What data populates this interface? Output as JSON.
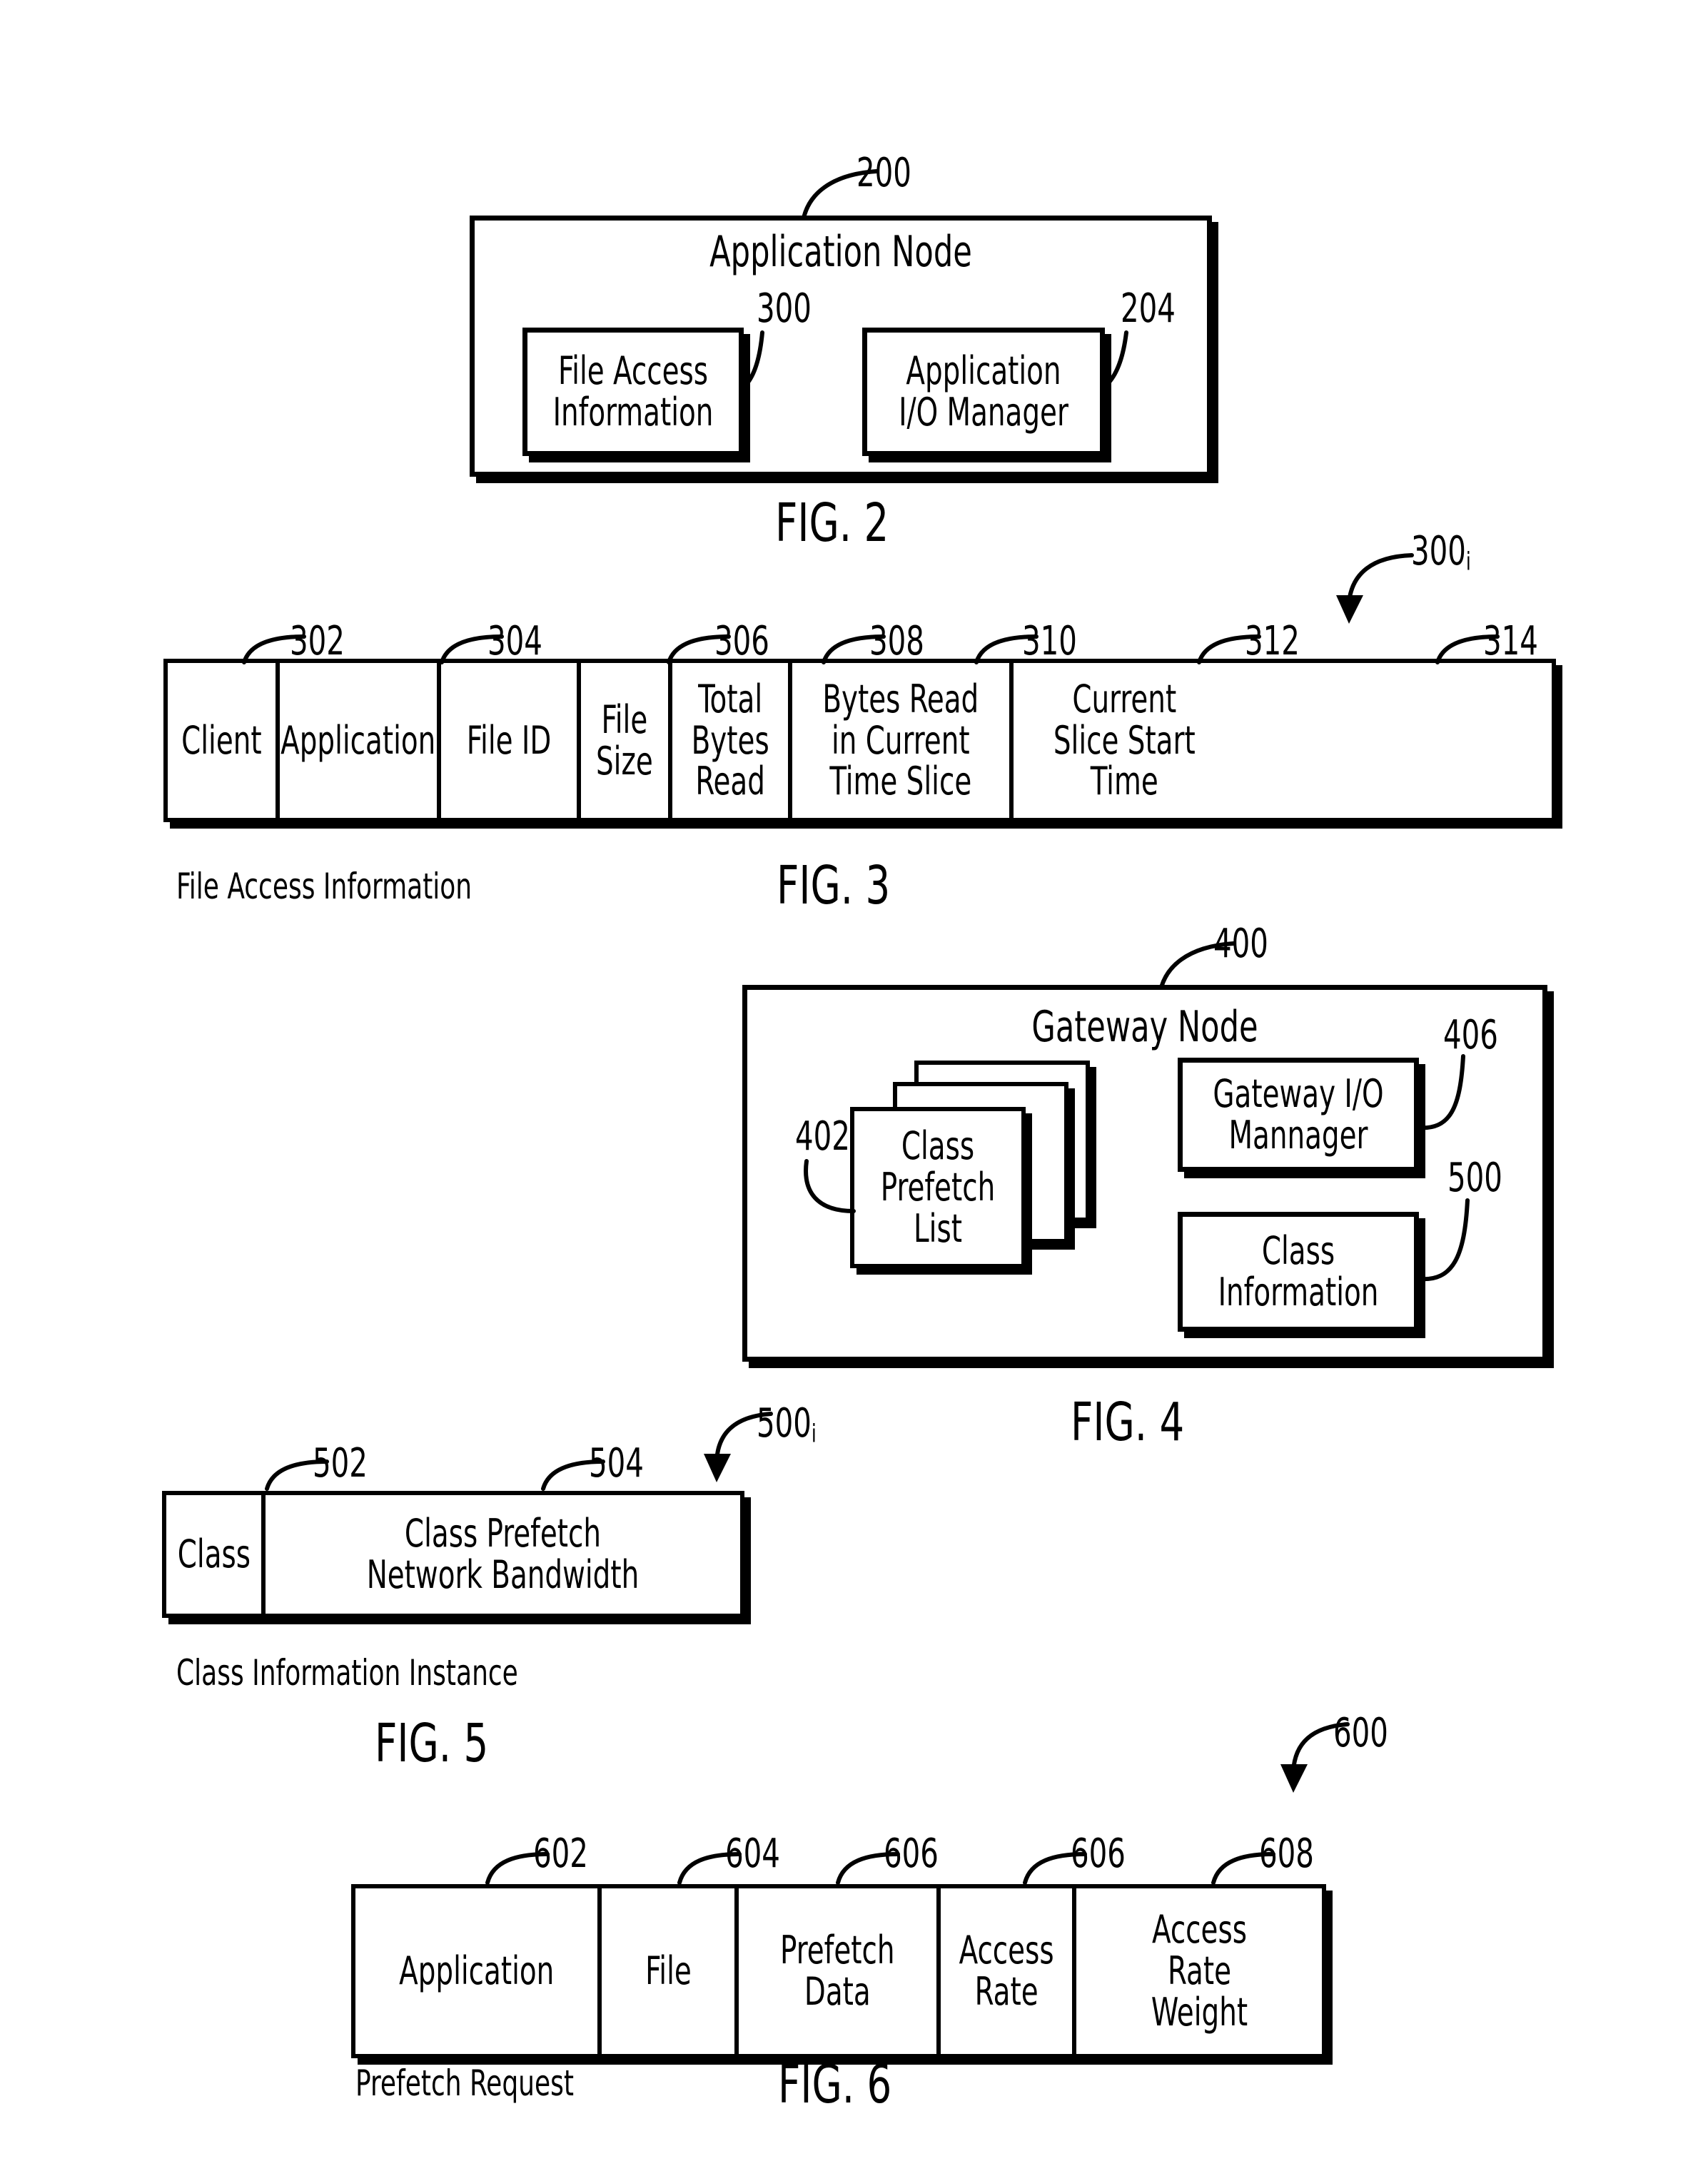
{
  "figures": [
    {
      "id": "fig2",
      "label": "FIG. 2",
      "ref": "200",
      "title": "Application Node",
      "blocks": [
        {
          "ref": "300",
          "label": "File Access\nInformation"
        },
        {
          "ref": "204",
          "label": "Application\nI/O Manager"
        }
      ]
    },
    {
      "id": "fig3",
      "label": "FIG. 3",
      "ref": "300i",
      "ref_base": "300",
      "ref_sub": "i",
      "caption": "File Access Information",
      "columns": [
        {
          "ref": "302",
          "label": "Client"
        },
        {
          "ref": "304",
          "label": "Application"
        },
        {
          "ref": "306",
          "label": "File ID"
        },
        {
          "ref": "308",
          "label": "File\nSize"
        },
        {
          "ref": "310",
          "label": "Total\nBytes\nRead"
        },
        {
          "ref": "312",
          "label": "Bytes Read\nin Current\nTime Slice"
        },
        {
          "ref": "314",
          "label": "Current\nSlice Start\nTime"
        }
      ]
    },
    {
      "id": "fig4",
      "label": "FIG. 4",
      "ref": "400",
      "title": "Gateway Node",
      "blocks": [
        {
          "ref": "402",
          "label": "Class\nPrefetch\nList",
          "style": "stack"
        },
        {
          "ref": "406",
          "label": "Gateway I/O\nMannager",
          "style": "box"
        },
        {
          "ref": "500",
          "label": "Class\nInformation",
          "style": "box"
        }
      ]
    },
    {
      "id": "fig5",
      "label": "FIG. 5",
      "ref": "500i",
      "ref_base": "500",
      "ref_sub": "i",
      "caption": "Class Information Instance",
      "columns": [
        {
          "ref": "502",
          "label": "Class"
        },
        {
          "ref": "504",
          "label": "Class Prefetch\nNetwork Bandwidth"
        }
      ]
    },
    {
      "id": "fig6",
      "label": "FIG. 6",
      "ref": "600",
      "caption": "Prefetch Request",
      "columns": [
        {
          "ref": "602",
          "label": "Application"
        },
        {
          "ref": "604",
          "label": "File"
        },
        {
          "ref": "606",
          "label": "Prefetch\nData"
        },
        {
          "ref": "606",
          "label": "Access\nRate"
        },
        {
          "ref": "608",
          "label": "Access\nRate\nWeight"
        }
      ]
    }
  ]
}
